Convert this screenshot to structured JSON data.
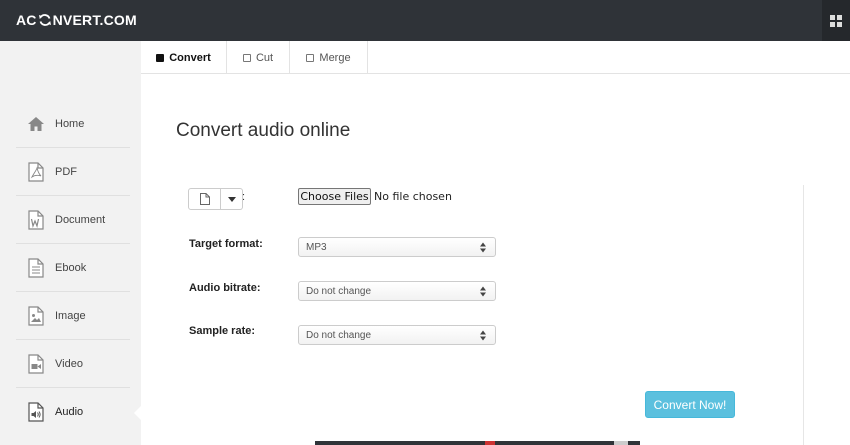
{
  "header": {
    "logo_part1": "AC",
    "logo_icon": "sync-icon",
    "logo_part2": "NVERT.COM",
    "grid_icon": "grid-icon"
  },
  "sidebar": {
    "items": [
      {
        "label": "Home",
        "icon": "home-icon"
      },
      {
        "label": "PDF",
        "icon": "pdf-file-icon"
      },
      {
        "label": "Document",
        "icon": "word-document-icon"
      },
      {
        "label": "Ebook",
        "icon": "ebook-icon"
      },
      {
        "label": "Image",
        "icon": "image-file-icon"
      },
      {
        "label": "Video",
        "icon": "video-file-icon"
      },
      {
        "label": "Audio",
        "icon": "audio-file-icon",
        "active": true
      }
    ]
  },
  "tabs": [
    {
      "label": "Convert",
      "active": true
    },
    {
      "label": "Cut"
    },
    {
      "label": "Merge"
    }
  ],
  "main": {
    "title": "Convert audio online",
    "source_colon": ":",
    "file": {
      "button_label": "Choose Files",
      "status": "No file chosen"
    },
    "fields": [
      {
        "label": "Target format:",
        "value": "MP3"
      },
      {
        "label": "Audio bitrate:",
        "value": "Do not change"
      },
      {
        "label": "Sample rate:",
        "value": "Do not change"
      }
    ],
    "convert_label": "Convert Now!"
  },
  "colors": {
    "topbar": "#2f3338",
    "sidebar": "#f2f2f2",
    "accent": "#5bc0de"
  }
}
